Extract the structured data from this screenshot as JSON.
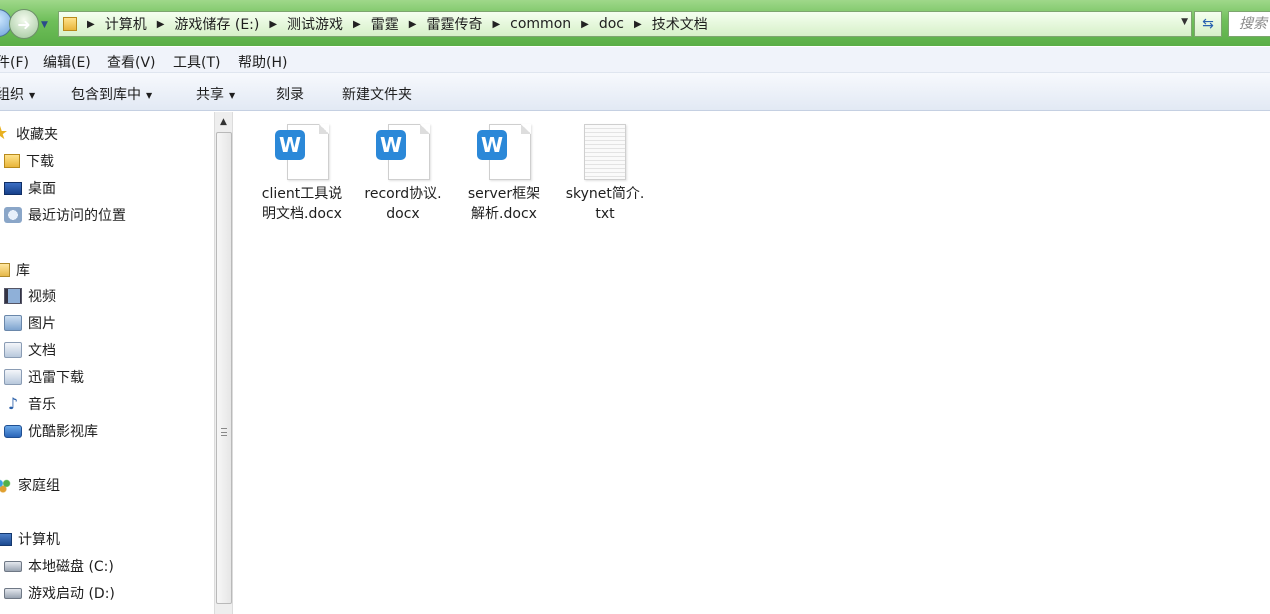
{
  "address": {
    "crumbs": [
      "计算机",
      "游戏储存 (E:)",
      "测试游戏",
      "雷霆",
      "雷霆传奇",
      "common",
      "doc",
      "技术文档"
    ],
    "search_placeholder": "搜索"
  },
  "menu": [
    "件(F)",
    "编辑(E)",
    "查看(V)",
    "工具(T)",
    "帮助(H)"
  ],
  "toolbar": {
    "organize": "组织",
    "include_library": "包含到库中",
    "share": "共享",
    "burn": "刻录",
    "new_folder": "新建文件夹"
  },
  "sidebar": {
    "favorites": {
      "label": "收藏夹",
      "items": [
        "下载",
        "桌面",
        "最近访问的位置"
      ]
    },
    "libraries": {
      "label": "库",
      "items": [
        "视频",
        "图片",
        "文档",
        "迅雷下载",
        "音乐",
        "优酷影视库"
      ]
    },
    "homegroup": {
      "label": "家庭组"
    },
    "computer": {
      "label": "计算机",
      "items": [
        "本地磁盘 (C:)",
        "游戏启动 (D:)"
      ]
    }
  },
  "files": [
    {
      "name": "client工具说明文档.docx",
      "type": "docx",
      "icon": "wps-word-icon"
    },
    {
      "name": "record协议.docx",
      "type": "docx",
      "icon": "wps-word-icon"
    },
    {
      "name": "server框架解析.docx",
      "type": "docx",
      "icon": "wps-word-icon"
    },
    {
      "name": "skynet简介.txt",
      "type": "txt",
      "icon": "text-file-icon"
    }
  ]
}
